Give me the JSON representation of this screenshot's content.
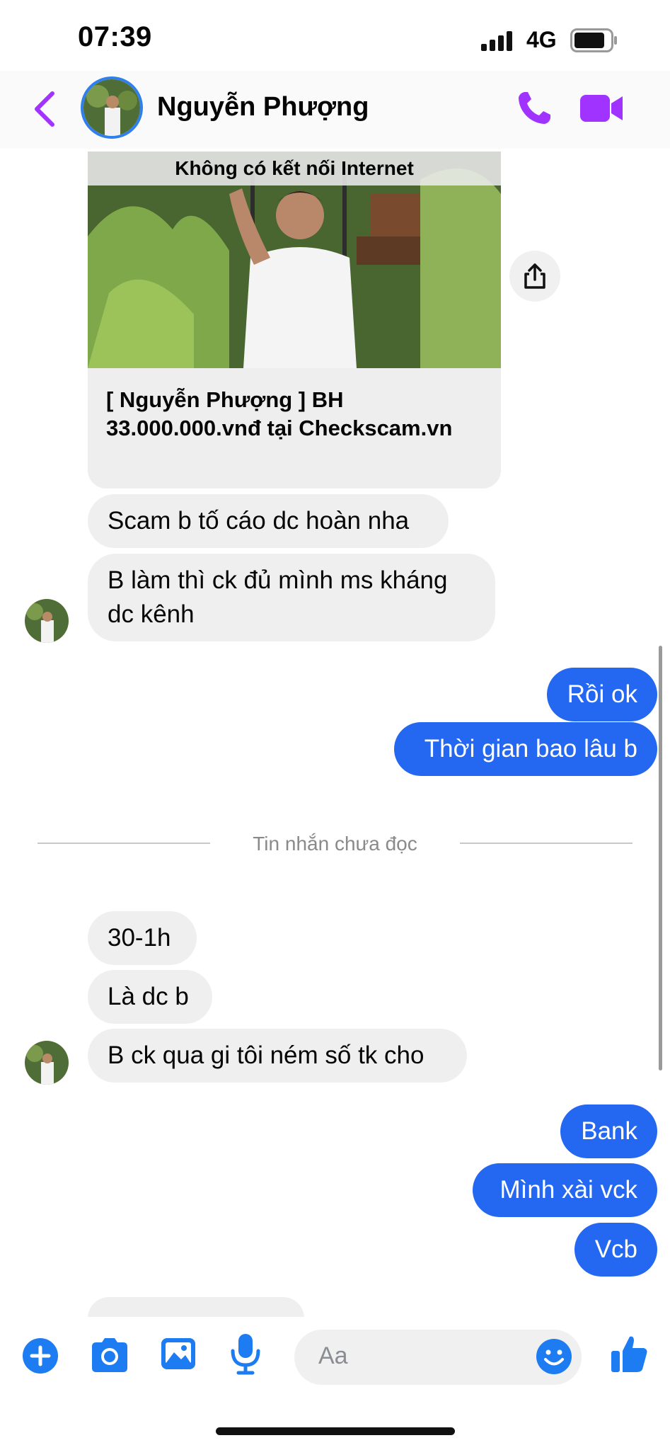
{
  "status_bar": {
    "time": "07:39",
    "network": "4G"
  },
  "header": {
    "contact_name": "Nguyễn Phượng"
  },
  "link_preview": {
    "banner": "Không có kết nối Internet",
    "title": "[ Nguyễn Phượng ] BH 33.000.000.vnđ tại Checkscam.vn"
  },
  "messages_before": [
    {
      "from": "them",
      "text": "Scam b tố cáo dc hoàn nha"
    },
    {
      "from": "them",
      "text": "B làm thì ck đủ mình ms kháng dc kênh"
    },
    {
      "from": "me",
      "text": "Rồi ok"
    },
    {
      "from": "me",
      "text": "Thời gian bao lâu b"
    }
  ],
  "unread_divider": "Tin nhắn chưa đọc",
  "messages_after": [
    {
      "from": "them",
      "text": "30-1h"
    },
    {
      "from": "them",
      "text": "Là dc b"
    },
    {
      "from": "them",
      "text": "B ck qua gi tôi ném số tk cho"
    },
    {
      "from": "me",
      "text": "Bank"
    },
    {
      "from": "me",
      "text": "Mình xài vck"
    },
    {
      "from": "me",
      "text": "Vcb"
    }
  ],
  "composer": {
    "placeholder": "Aa",
    "icons": [
      "plus-icon",
      "camera-icon",
      "gallery-icon",
      "microphone-icon",
      "emoji-icon",
      "thumbs-up-icon"
    ]
  },
  "colors": {
    "accent_purple": "#a033ff",
    "outgoing_bubble": "#2468f2",
    "composer_blue": "#1e7cf2",
    "incoming_bubble": "#efefef"
  }
}
